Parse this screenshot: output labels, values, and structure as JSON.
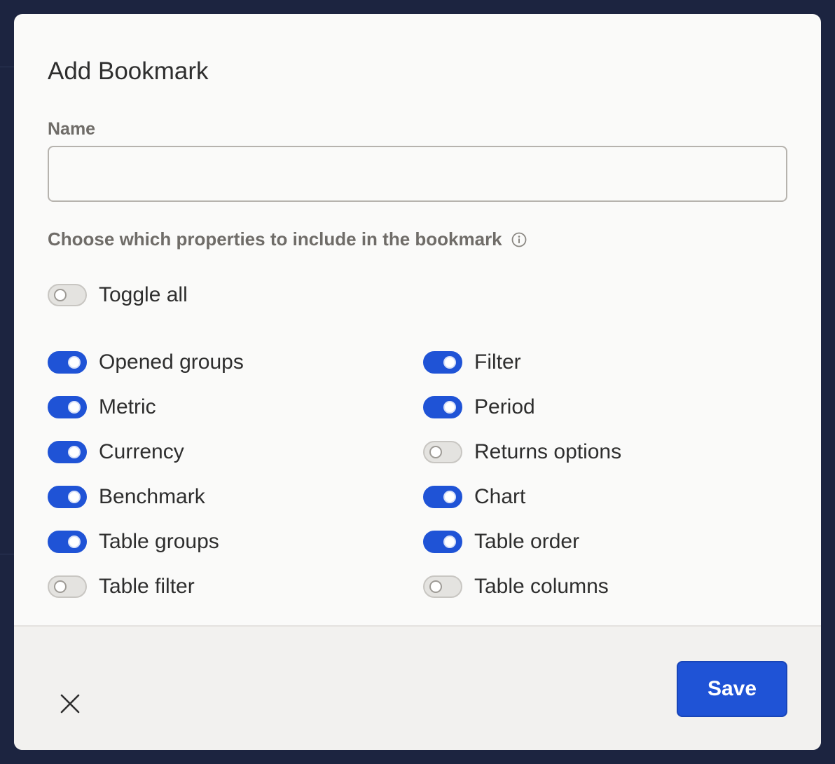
{
  "dialog": {
    "title": "Add Bookmark",
    "name_label": "Name",
    "name_value": "",
    "name_placeholder": "",
    "properties_label": "Choose which properties to include in the bookmark",
    "toggle_all": {
      "label": "Toggle all",
      "on": false
    },
    "left_column": [
      {
        "label": "Opened groups",
        "on": true
      },
      {
        "label": "Metric",
        "on": true
      },
      {
        "label": "Currency",
        "on": true
      },
      {
        "label": "Benchmark",
        "on": true
      },
      {
        "label": "Table groups",
        "on": true
      },
      {
        "label": "Table filter",
        "on": false
      }
    ],
    "right_column": [
      {
        "label": "Filter",
        "on": true
      },
      {
        "label": "Period",
        "on": true
      },
      {
        "label": "Returns options",
        "on": false
      },
      {
        "label": "Chart",
        "on": true
      },
      {
        "label": "Table order",
        "on": true
      },
      {
        "label": "Table columns",
        "on": false
      }
    ],
    "save_label": "Save",
    "close_icon": "close-icon",
    "info_icon": "info-icon"
  },
  "colors": {
    "accent": "#1f53d6",
    "toggle_off": "#e4e3e0",
    "backdrop": "#1c2440"
  }
}
